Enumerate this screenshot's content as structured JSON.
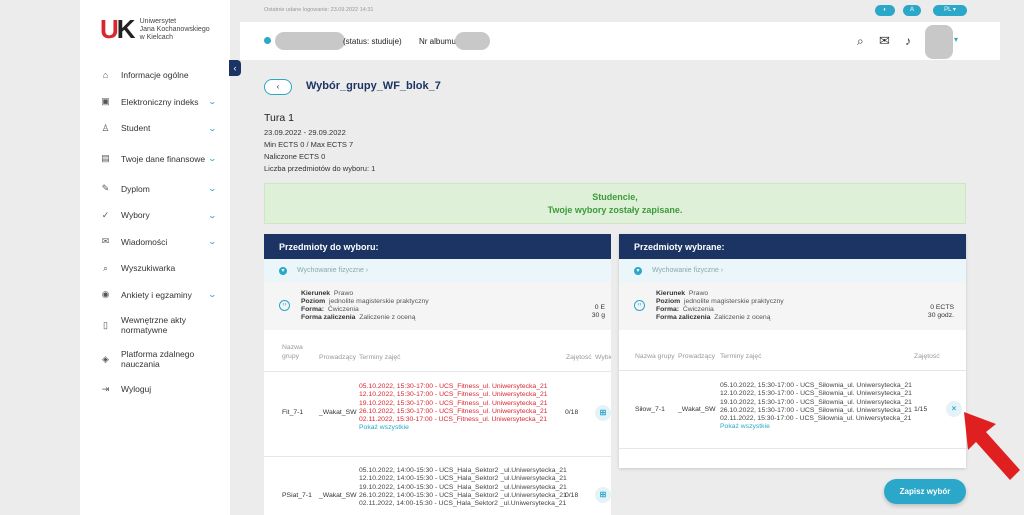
{
  "logo": {
    "mark": "UK",
    "line1": "Uniwersytet",
    "line2": "Jana Kochanowskiego",
    "line3": "w Kielcach"
  },
  "sidebar": {
    "items": [
      {
        "label": "Informacje ogólne",
        "icon": "home-icon",
        "glyph": "⌂",
        "chev": false
      },
      {
        "label": "Elektroniczny indeks",
        "icon": "id-card-icon",
        "glyph": "▣",
        "chev": true
      },
      {
        "label": "Student",
        "icon": "user-icon",
        "glyph": "♙",
        "chev": true
      },
      {
        "label": "Twoje dane finansowe",
        "icon": "money-icon",
        "glyph": "▤",
        "chev": true
      },
      {
        "label": "Dyplom",
        "icon": "diploma-icon",
        "glyph": "✎",
        "chev": true
      },
      {
        "label": "Wybory",
        "icon": "check-icon",
        "glyph": "✓",
        "chev": true
      },
      {
        "label": "Wiadomości",
        "icon": "mail-icon",
        "glyph": "✉",
        "chev": true
      },
      {
        "label": "Wyszukiwarka",
        "icon": "search-icon",
        "glyph": "⌕",
        "chev": false
      },
      {
        "label": "Ankiety i egzaminy",
        "icon": "survey-icon",
        "glyph": "◉",
        "chev": true
      },
      {
        "label": "Wewnętrzne akty normatywne",
        "icon": "document-icon",
        "glyph": "▯",
        "chev": false
      },
      {
        "label": "Platforma zdalnego nauczania",
        "icon": "platform-icon",
        "glyph": "◈",
        "chev": false
      },
      {
        "label": "Wyloguj",
        "icon": "logout-icon",
        "glyph": "⇥",
        "chev": false
      }
    ]
  },
  "topbar": {
    "last_login": "Ostatnie udane logowanie: 23.09.2022 14:31",
    "contrast": "◐",
    "font": "A",
    "lang": "PL"
  },
  "header": {
    "status": "(status: studiuje)",
    "album_label": "Nr albumu"
  },
  "main": {
    "back": "‹",
    "title": "Wybór_grupy_WF_blok_7",
    "tour": "Tura 1",
    "dates": "23.09.2022 - 29.09.2022",
    "ects_range": "Min ECTS 0 / Max ECTS 7",
    "ects_counted": "Naliczone ECTS 0",
    "subjects_count": "Liczba przedmiotów do wyboru: 1",
    "success_line1": "Studencie,",
    "success_line2": "Twoje wybory zostały zapisane."
  },
  "left_panel": {
    "title": "Przedmioty do wyboru:",
    "subject": "Wychowanie fizyczne ›",
    "info": {
      "kierunek_l": "Kierunek",
      "kierunek": "Prawo",
      "poziom_l": "Poziom",
      "poziom": "jednolite magisterskie praktyczny",
      "forma_l": "Forma:",
      "forma": "Ćwiczenia",
      "zal_l": "Forma zaliczenia",
      "zal": "Zaliczenie z oceną",
      "ects": "0 E",
      "hours": "30 g"
    },
    "cols": {
      "group": "Nazwa grupy",
      "lecturer": "Prowadzący",
      "terms": "Terminy zajęć",
      "occupancy": "Zajętość",
      "choose": "Wybie"
    },
    "rows": [
      {
        "group": "Fit_7-1",
        "lecturer": "_Wakat_SW",
        "terms": [
          "05.10.2022, 15:30-17:00 - UCS_Fitness_ul. Uniwersytecka_21",
          "12.10.2022, 15:30-17:00 - UCS_Fitness_ul. Uniwersytecka_21",
          "19.10.2022, 15:30-17:00 - UCS_Fitness_ul. Uniwersytecka_21",
          "26.10.2022, 15:30-17:00 - UCS_Fitness_ul. Uniwersytecka_21",
          "02.11.2022, 15:30-17:00 - UCS_Fitness_ul. Uniwersytecka_21"
        ],
        "show_all": "Pokaż wszystkie",
        "occupancy": "0/18"
      },
      {
        "group": "PSiat_7-1",
        "lecturer": "_Wakat_SW",
        "terms": [
          "05.10.2022, 14:00-15:30 - UCS_Hala_Sektor2 _ul.Uniwersytecka_21",
          "12.10.2022, 14:00-15:30 - UCS_Hala_Sektor2 _ul.Uniwersytecka_21",
          "19.10.2022, 14:00-15:30 - UCS_Hala_Sektor2 _ul.Uniwersytecka_21",
          "26.10.2022, 14:00-15:30 - UCS_Hala_Sektor2 _ul.Uniwersytecka_21",
          "02.11.2022, 14:00-15:30 - UCS_Hala_Sektor2 _ul.Uniwersytecka_21"
        ],
        "occupancy": "0/18"
      }
    ]
  },
  "right_panel": {
    "title": "Przedmioty wybrane:",
    "subject": "Wychowanie fizyczne ›",
    "info": {
      "kierunek_l": "Kierunek",
      "kierunek": "Prawo",
      "poziom_l": "Poziom",
      "poziom": "jednolite magisterskie praktyczny",
      "forma_l": "Forma:",
      "forma": "Ćwiczenia",
      "zal_l": "Forma zaliczenia",
      "zal": "Zaliczenie z oceną",
      "ects": "0 ECTS",
      "hours": "30 godz."
    },
    "cols": {
      "group": "Nazwa grupy",
      "lecturer": "Prowadzący",
      "terms": "Terminy zajęć",
      "occupancy": "Zajętość"
    },
    "row": {
      "group": "Siłow_7-1",
      "lecturer": "_Wakat_SW",
      "terms": [
        "05.10.2022, 15:30-17:00 - UCS_Siłownia_ul. Uniwersytecka_21",
        "12.10.2022, 15:30-17:00 - UCS_Siłownia_ul. Uniwersytecka_21",
        "19.10.2022, 15:30-17:00 - UCS_Siłownia_ul. Uniwersytecka_21",
        "26.10.2022, 15:30-17:00 - UCS_Siłownia_ul. Uniwersytecka_21",
        "02.11.2022, 15:30-17:00 - UCS_Siłownia_ul. Uniwersytecka_21"
      ],
      "show_all": "Pokaż wszystkie",
      "occupancy": "1/15",
      "remove": "×"
    }
  },
  "save_label": "Zapisz wybór",
  "colors": {
    "navy": "#1c3464",
    "accent": "#2aa7c9",
    "red": "#d9262f",
    "success_bg": "#dff0d8"
  }
}
